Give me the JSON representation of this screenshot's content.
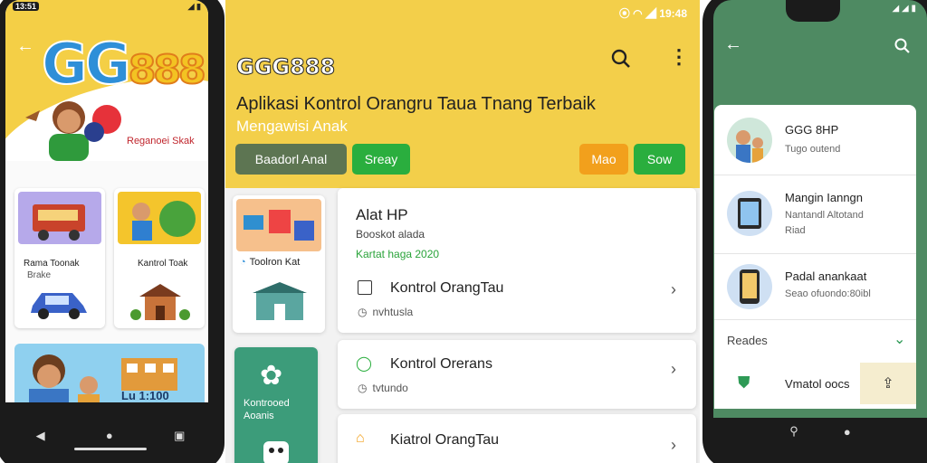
{
  "left": {
    "status_time": "13:51",
    "logo_gg": "GG",
    "logo_num": "888",
    "hero_caption": "Reganoei Skak",
    "tile1_title": "Rama Toonak",
    "tile1_sub": "Brake",
    "tile2_title": "Kantrol Toak",
    "tile3_title": "Toonron Kat",
    "banner_text": "Lu 1:100",
    "colors": {
      "yellow": "#f4cf46",
      "frame": "#1b1b1b"
    }
  },
  "middle": {
    "status_time": "19:48",
    "logo": "GGG888",
    "title": "Aplikasi Kontrol Orangru Taua Tnang Terbaik",
    "subtitle": "Mengawisi Anak",
    "btn_left": "Baadorl Anal",
    "btn_left2": "Sreay",
    "btn_right1": "Mao",
    "btn_right2": "Sow",
    "section_title": "Alat HP",
    "section_sub": "Booskot alada",
    "section_date": "Kartat haga 2020",
    "row1_title": "Kontrol OrangTau",
    "row1_sub": "nvhtusla",
    "row2_title": "Kontrol Orerans",
    "row2_sub": "tvtundo",
    "row3_title": "Kiatrol OrangTau",
    "side_card_title": "Toolron Kat",
    "side_green_title": "Kontrooed",
    "side_green_sub": "Aoanis",
    "colors": {
      "yellow": "#f3cf4a",
      "green": "#2aae3e",
      "orange": "#f2a01c",
      "olive": "#5d7552",
      "teal": "#3c9c7a"
    }
  },
  "right": {
    "item1_title": "GGG 8HP",
    "item1_sub": "Tugo outend",
    "item2_title": "Mangin Ianngn",
    "item2_sub1": "Nantandl Altotand",
    "item2_sub2": "Riad",
    "item3_title": "Padal anankaat",
    "item3_sub": "Seao ofuondo:80ibl",
    "section_label": "Reades",
    "item4_title": "Vmatol oocs",
    "colors": {
      "green": "#4e8a62",
      "accent": "#2e9a56"
    }
  }
}
